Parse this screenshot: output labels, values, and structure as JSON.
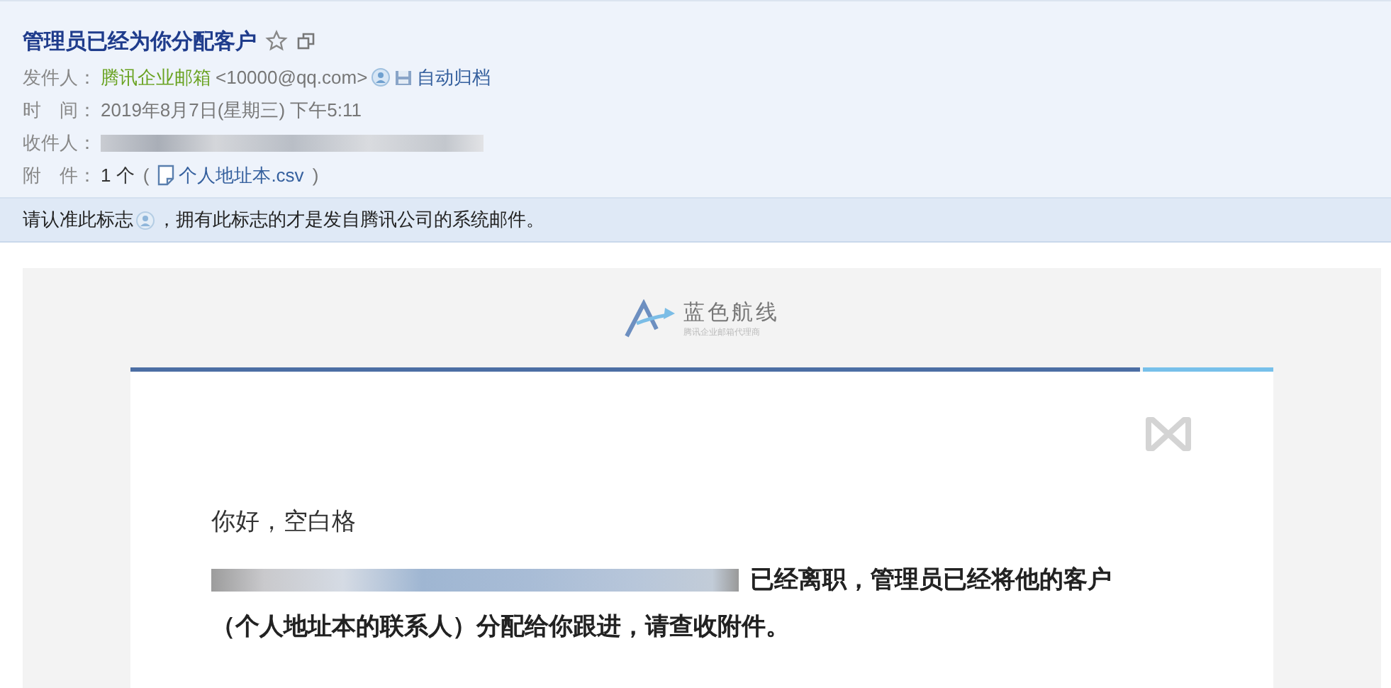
{
  "header": {
    "subject": "管理员已经为你分配客户",
    "sender": {
      "label": "发件人：",
      "name": "腾讯企业邮箱",
      "address": "<10000@qq.com>",
      "archive": "自动归档"
    },
    "time": {
      "label": "时　间：",
      "value": "2019年8月7日(星期三) 下午5:11"
    },
    "recipient": {
      "label": "收件人："
    },
    "attachment": {
      "label": "附　件：",
      "count": "1 个",
      "open": "(",
      "file": "个人地址本.csv",
      "close": ")"
    }
  },
  "notice": {
    "before": "请认准此标志",
    "after": "，拥有此标志的才是发自腾讯公司的系统邮件。"
  },
  "body": {
    "brand": {
      "name": "蓝色航线",
      "tagline": "腾讯企业邮箱代理商"
    },
    "greeting": "你好，空白格",
    "message_1": "已经离职，管理员已经将他的客户",
    "message_2": "（个人地址本的联系人）分配给你跟进，请查收附件。"
  }
}
